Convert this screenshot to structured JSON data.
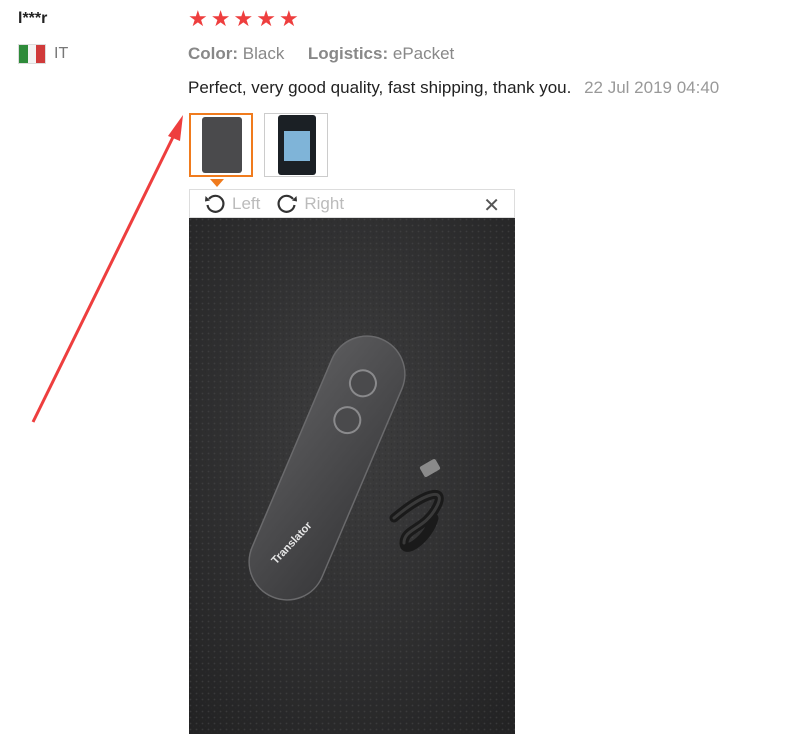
{
  "reviewer": {
    "name": "l***r",
    "country": "IT"
  },
  "rating": {
    "stars": 5,
    "max": 5
  },
  "attributes": {
    "color_key": "Color:",
    "color_value": "Black",
    "logistics_key": "Logistics:",
    "logistics_value": "ePacket"
  },
  "comment": {
    "text": "Perfect, very good quality, fast shipping, thank you.",
    "date": "22 Jul 2019 04:40"
  },
  "viewer": {
    "rotate_left": "Left",
    "rotate_right": "Right",
    "close": "✕"
  },
  "photo": {
    "device_text": "Translator"
  },
  "colors": {
    "star": "#ee3e3e",
    "selected_border": "#f07b1d",
    "annotation_arrow": "#ee3e3e"
  }
}
